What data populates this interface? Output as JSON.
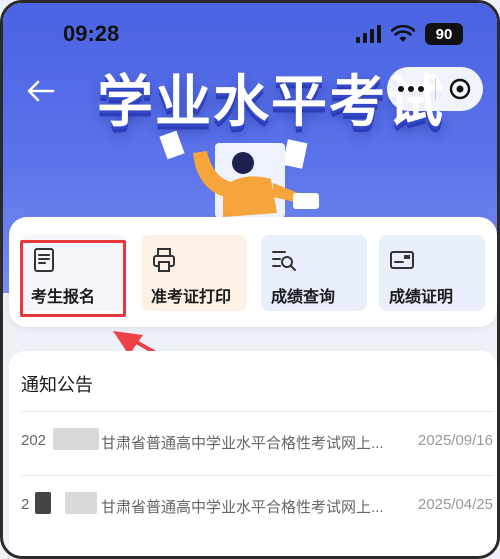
{
  "status": {
    "time": "09:28",
    "battery": "90"
  },
  "hero": {
    "title": "学业水平考试"
  },
  "functions": [
    {
      "label": "考生报名",
      "icon": "document-icon",
      "bg": "#f4f6fc"
    },
    {
      "label": "准考证打印",
      "icon": "printer-icon",
      "bg": "#fdf1e6"
    },
    {
      "label": "成绩查询",
      "icon": "search-list-icon",
      "bg": "#e8eefc"
    },
    {
      "label": "成绩证明",
      "icon": "certificate-icon",
      "bg": "#e8eefc"
    }
  ],
  "notices": {
    "title": "通知公告",
    "items": [
      {
        "prefix": "202",
        "title": "甘肃省普通高中学业水平合格性考试网上...",
        "date": "2025/09/16"
      },
      {
        "prefix": "2",
        "title": "甘肃省普通高中学业水平合格性考试网上...",
        "date": "2025/04/25"
      }
    ]
  },
  "colors": {
    "brand": "#4a63e3",
    "highlight": "#e5383b"
  }
}
